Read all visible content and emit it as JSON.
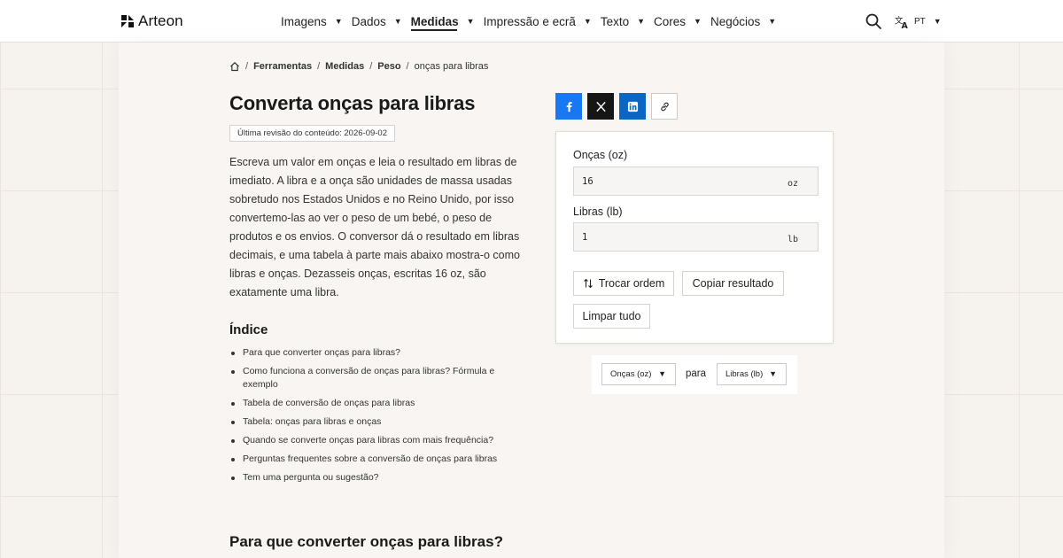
{
  "brand": {
    "name": "Arteon"
  },
  "nav": {
    "items": [
      {
        "label": "Imagens"
      },
      {
        "label": "Dados"
      },
      {
        "label": "Medidas"
      },
      {
        "label": "Impressão e ecrã"
      },
      {
        "label": "Texto"
      },
      {
        "label": "Cores"
      },
      {
        "label": "Negócios"
      }
    ],
    "active_index": 2,
    "language": "PT"
  },
  "breadcrumb": {
    "items": [
      "Ferramentas",
      "Medidas",
      "Peso"
    ],
    "current": "onças para libras"
  },
  "page": {
    "title": "Converta onças para libras",
    "revision": "Última revisão do conteúdo: 2026-09-02",
    "intro": "Escreva um valor em onças e leia o resultado em libras de imediato. A libra e a onça são unidades de massa usadas sobretudo nos Estados Unidos e no Reino Unido, por isso convertemo-las ao ver o peso de um bebé, o peso de produtos e os envios. O conversor dá o resultado em libras decimais, e uma tabela à parte mais abaixo mostra-o como libras e onças. Dezasseis onças, escritas 16 oz, são exatamente uma libra.",
    "toc_title": "Índice",
    "toc": [
      "Para que converter onças para libras?",
      "Como funciona a conversão de onças para libras? Fórmula e exemplo",
      "Tabela de conversão de onças para libras",
      "Tabela: onças para libras e onças",
      "Quando se converte onças para libras com mais frequência?",
      "Perguntas frequentes sobre a conversão de onças para libras",
      "Tem uma pergunta ou sugestão?"
    ],
    "section_title": "Para que converter onças para libras?"
  },
  "converter": {
    "from_label": "Onças (oz)",
    "from_value": "16",
    "from_unit": "oz",
    "to_label": "Libras (lb)",
    "to_value": "1",
    "to_unit": "lb",
    "swap_label": "Trocar ordem",
    "copy_label": "Copiar resultado",
    "clear_label": "Limpar tudo"
  },
  "unit_select": {
    "from": "Onças (oz)",
    "connector": "para",
    "to": "Libras (lb)"
  },
  "share_icons": [
    "facebook-icon",
    "x-icon",
    "linkedin-icon",
    "link-icon"
  ],
  "colors": {
    "facebook": "#1877f2",
    "x": "#161616",
    "linkedin": "#0a66c2",
    "background": "#f6f2ee"
  }
}
